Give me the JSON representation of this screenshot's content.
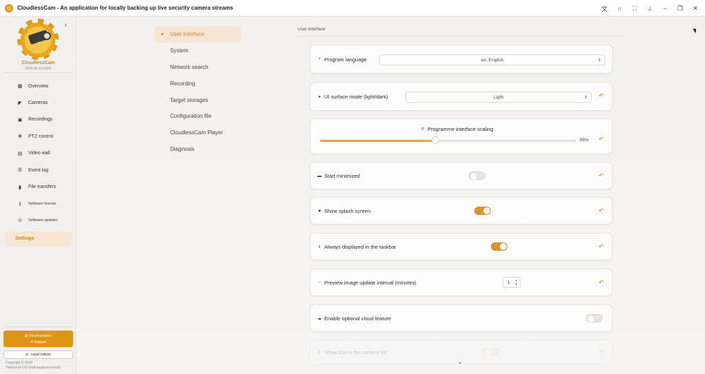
{
  "window": {
    "title": "CloudlessCam - An application for locally backing up live security camera streams",
    "controls": [
      "translate-icon",
      "theme-icon",
      "fullscreen-icon",
      "pin-icon",
      "minimize-icon",
      "restore-icon",
      "close-icon"
    ]
  },
  "brand": {
    "name": "CloudlessCam",
    "version": "2026.05.19.1900"
  },
  "sidebar": {
    "items": [
      {
        "label": "Overview",
        "icon": "grid-icon"
      },
      {
        "label": "Cameras",
        "icon": "camera-icon"
      },
      {
        "label": "Recordings",
        "icon": "recordings-icon"
      },
      {
        "label": "PTZ control",
        "icon": "move-icon"
      },
      {
        "label": "Video wall",
        "icon": "monitor-icon"
      },
      {
        "label": "Event log",
        "icon": "list-icon"
      },
      {
        "label": "File transfers",
        "icon": "file-icon"
      },
      {
        "label": "Software license",
        "icon": "key-icon"
      },
      {
        "label": "Software updates",
        "icon": "update-icon"
      },
      {
        "label": "Settings",
        "icon": ""
      }
    ],
    "active": "Settings",
    "documentation": "Documentation",
    "support": "Support",
    "legal": "Legal notices",
    "copyright_line1": "Copyright © 2024",
    "copyright_line2": "Tadebucht UG (haftungsbeschränkt)"
  },
  "settings_nav": {
    "items": [
      "User interface",
      "System",
      "Network search",
      "Recording",
      "Target storages",
      "Configuration file",
      "CloudlessCam Player",
      "Diagnosis"
    ],
    "active": "User interface"
  },
  "section": {
    "title": "User interface"
  },
  "settings": {
    "language": {
      "label": "Program language",
      "value": "en: English"
    },
    "surface_mode": {
      "label": "UI surface mode (light/dark)",
      "value": "Light"
    },
    "scaling": {
      "label": "Programme interface scaling",
      "value": "95%",
      "fraction": 0.45
    },
    "start_minimized": {
      "label": "Start minimized",
      "enabled": false
    },
    "splash_screen": {
      "label": "Show splash screen",
      "enabled": true
    },
    "taskbar": {
      "label": "Always displayed in the taskbar",
      "enabled": true
    },
    "preview_interval": {
      "label": "Preview image update interval (minutes)",
      "value": "1"
    },
    "cloud_feature": {
      "label": "Enable optional cloud feature",
      "enabled": false
    },
    "show_ids": {
      "label": "Show IDs in the camera list"
    }
  },
  "colors": {
    "accent": "#d9861a",
    "toggle_on": "#d9952a",
    "active_bg": "#f6e5d3"
  }
}
